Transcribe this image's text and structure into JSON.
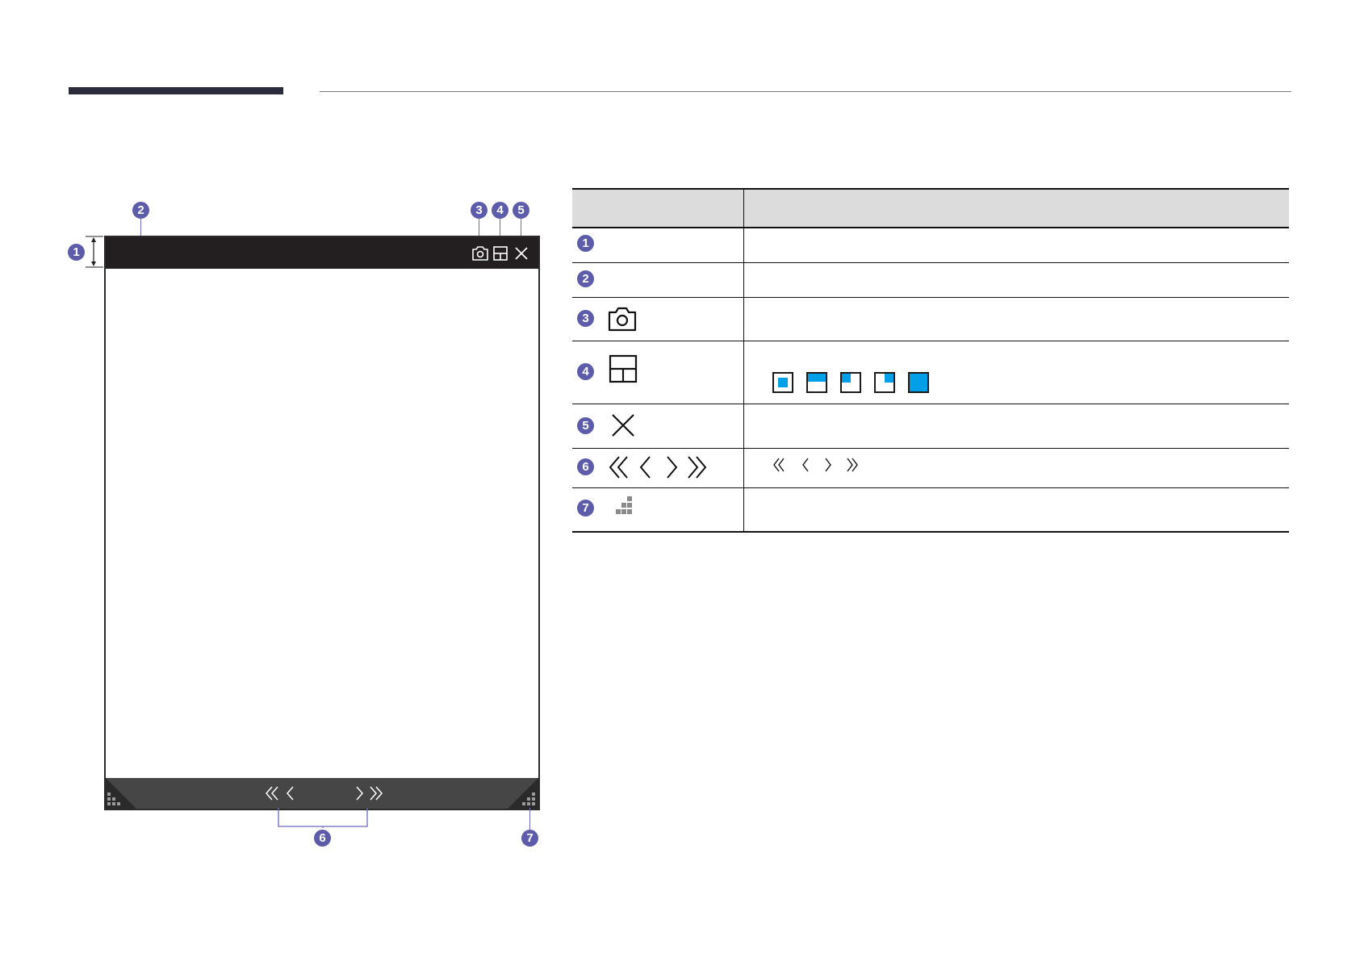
{
  "callouts": [
    "1",
    "2",
    "3",
    "4",
    "5",
    "6",
    "7"
  ],
  "table": {
    "header": [
      "",
      ""
    ],
    "rows": [
      {
        "num": "1",
        "icon": "",
        "description": ""
      },
      {
        "num": "2",
        "icon": "",
        "description": ""
      },
      {
        "num": "3",
        "icon": "camera-icon",
        "description": ""
      },
      {
        "num": "4",
        "icon": "layout-icon",
        "description": "",
        "layout_options": [
          "small-center",
          "top-half",
          "top-left-quarter",
          "top-right-quarter",
          "full"
        ]
      },
      {
        "num": "5",
        "icon": "close-icon",
        "description": ""
      },
      {
        "num": "6",
        "icon": "page-navigation-icons",
        "description": "",
        "nav_icons": [
          "double-left-icon",
          "left-icon",
          "right-icon",
          "double-right-icon"
        ]
      },
      {
        "num": "7",
        "icon": "resize-grip-icon",
        "description": ""
      }
    ]
  },
  "colors": {
    "callout": "#5c5cab",
    "titlebar": "#231f20",
    "bottombar": "#464646",
    "accent": "#00a0e9",
    "header_bar": "#2b2b3b"
  }
}
